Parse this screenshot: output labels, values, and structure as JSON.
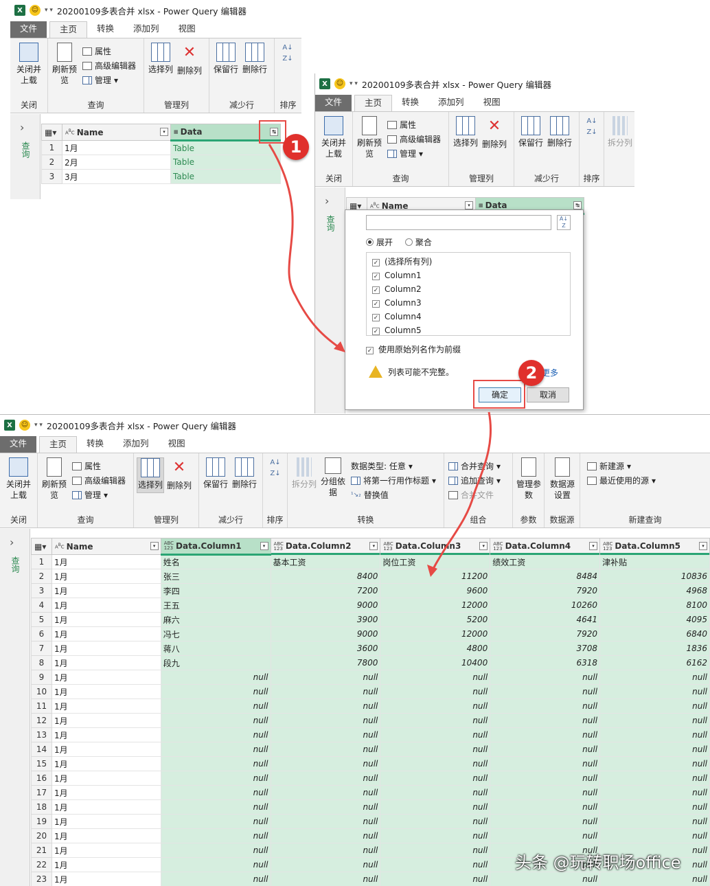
{
  "w1": {
    "title": "20200109多表合并 xlsx - Power Query 编辑器",
    "tabs": [
      "文件",
      "主页",
      "转换",
      "添加列",
      "视图"
    ],
    "ribbon": {
      "close_load": "关闭并上载",
      "refresh": "刷新预览",
      "properties": "属性",
      "advanced_editor": "高级编辑器",
      "manage": "管理",
      "select_cols": "选择列",
      "remove_cols": "删除列",
      "keep_rows": "保留行",
      "remove_rows": "删除行",
      "groups": [
        "关闭",
        "查询",
        "管理列",
        "减少行",
        "排序"
      ]
    },
    "sidebar_label": "查询",
    "columns": [
      "Name",
      "Data"
    ],
    "rows": [
      {
        "n": "1",
        "name": "1月",
        "data": "Table"
      },
      {
        "n": "2",
        "name": "2月",
        "data": "Table"
      },
      {
        "n": "3",
        "name": "3月",
        "data": "Table"
      }
    ]
  },
  "w2": {
    "title": "20200109多表合并 xlsx - Power Query 编辑器",
    "tabs": [
      "文件",
      "主页",
      "转换",
      "添加列",
      "视图"
    ],
    "ribbon": {
      "close_load": "关闭并上载",
      "refresh": "刷新预览",
      "properties": "属性",
      "advanced_editor": "高级编辑器",
      "manage": "管理",
      "select_cols": "选择列",
      "remove_cols": "删除列",
      "keep_rows": "保留行",
      "remove_rows": "删除行",
      "split": "拆分列",
      "groups": [
        "关闭",
        "查询",
        "管理列",
        "减少行",
        "排序"
      ]
    },
    "sidebar_label": "查询",
    "columns": [
      "Name",
      "Data"
    ],
    "dialog": {
      "expand": "展开",
      "aggregate": "聚合",
      "items": [
        "(选择所有列)",
        "Column1",
        "Column2",
        "Column3",
        "Column4",
        "Column5"
      ],
      "prefix": "使用原始列名作为前缀",
      "warning": "列表可能不完整。",
      "load_more": "加载更多",
      "ok": "确定",
      "cancel": "取消"
    }
  },
  "w3": {
    "title": "20200109多表合并 xlsx - Power Query 编辑器",
    "tabs": [
      "文件",
      "主页",
      "转换",
      "添加列",
      "视图"
    ],
    "ribbon": {
      "close_load": "关闭并上载",
      "refresh": "刷新预览",
      "properties": "属性",
      "advanced_editor": "高级编辑器",
      "manage": "管理",
      "select_cols": "选择列",
      "remove_cols": "删除列",
      "keep_rows": "保留行",
      "remove_rows": "删除行",
      "split": "拆分列",
      "group_by": "分组依据",
      "data_type": "数据类型: 任意",
      "first_row_header": "将第一行用作标题",
      "replace": "替换值",
      "merge_queries": "合并查询",
      "append_queries": "追加查询",
      "combine_files": "合并文件",
      "manage_params": "管理参数",
      "datasource": "数据源设置",
      "new_source": "新建源",
      "recent": "最近使用的源",
      "groups": [
        "关闭",
        "查询",
        "管理列",
        "减少行",
        "排序",
        "转换",
        "组合",
        "参数",
        "数据源",
        "新建查询"
      ]
    },
    "sidebar_label": "查询",
    "columns": [
      "Name",
      "Data.Column1",
      "Data.Column2",
      "Data.Column3",
      "Data.Column4",
      "Data.Column5"
    ],
    "rows": [
      [
        "1",
        "1月",
        "姓名",
        "基本工资",
        "岗位工资",
        "绩效工资",
        "津补贴"
      ],
      [
        "2",
        "1月",
        "张三",
        "8400",
        "11200",
        "8484",
        "10836"
      ],
      [
        "3",
        "1月",
        "李四",
        "7200",
        "9600",
        "7920",
        "4968"
      ],
      [
        "4",
        "1月",
        "王五",
        "9000",
        "12000",
        "10260",
        "8100"
      ],
      [
        "5",
        "1月",
        "麻六",
        "3900",
        "5200",
        "4641",
        "4095"
      ],
      [
        "6",
        "1月",
        "冯七",
        "9000",
        "12000",
        "7920",
        "6840"
      ],
      [
        "7",
        "1月",
        "蒋八",
        "3600",
        "4800",
        "3708",
        "1836"
      ],
      [
        "8",
        "1月",
        "段九",
        "7800",
        "10400",
        "6318",
        "6162"
      ],
      [
        "9",
        "1月",
        "null",
        "null",
        "null",
        "null",
        "null"
      ],
      [
        "10",
        "1月",
        "null",
        "null",
        "null",
        "null",
        "null"
      ],
      [
        "11",
        "1月",
        "null",
        "null",
        "null",
        "null",
        "null"
      ],
      [
        "12",
        "1月",
        "null",
        "null",
        "null",
        "null",
        "null"
      ],
      [
        "13",
        "1月",
        "null",
        "null",
        "null",
        "null",
        "null"
      ],
      [
        "14",
        "1月",
        "null",
        "null",
        "null",
        "null",
        "null"
      ],
      [
        "15",
        "1月",
        "null",
        "null",
        "null",
        "null",
        "null"
      ],
      [
        "16",
        "1月",
        "null",
        "null",
        "null",
        "null",
        "null"
      ],
      [
        "17",
        "1月",
        "null",
        "null",
        "null",
        "null",
        "null"
      ],
      [
        "18",
        "1月",
        "null",
        "null",
        "null",
        "null",
        "null"
      ],
      [
        "19",
        "1月",
        "null",
        "null",
        "null",
        "null",
        "null"
      ],
      [
        "20",
        "1月",
        "null",
        "null",
        "null",
        "null",
        "null"
      ],
      [
        "21",
        "1月",
        "null",
        "null",
        "null",
        "null",
        "null"
      ],
      [
        "22",
        "1月",
        "null",
        "null",
        "null",
        "null",
        "null"
      ],
      [
        "23",
        "1月",
        "null",
        "null",
        "null",
        "null",
        "null"
      ]
    ]
  },
  "badges": [
    "1",
    "2"
  ],
  "watermark": "头条 @玩转职场office"
}
